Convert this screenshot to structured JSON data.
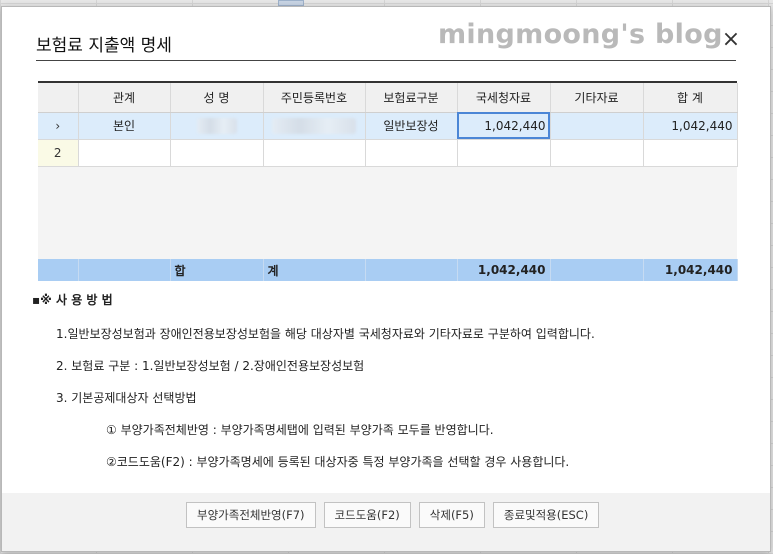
{
  "dialog": {
    "title": "보험료 지출액 명세",
    "watermark": "mingmoong's blog",
    "close_glyph": "×"
  },
  "grid": {
    "headers": [
      "관계",
      "성 명",
      "주민등록번호",
      "보험료구분",
      "국세청자료",
      "기타자료",
      "합 계"
    ],
    "rows": [
      {
        "marker": "›",
        "relation": "본인",
        "name": "",
        "id_number": "",
        "type": "일반보장성",
        "nts": "1,042,440",
        "other": "",
        "total": "1,042,440"
      },
      {
        "marker": "2",
        "relation": "",
        "name": "",
        "id_number": "",
        "type": "",
        "nts": "",
        "other": "",
        "total": ""
      }
    ],
    "totals": {
      "label1": "합",
      "label2": "계",
      "nts": "1,042,440",
      "total": "1,042,440"
    }
  },
  "notes": {
    "heading": "▪※ 사 용 방 법",
    "line1": "1.일반보장성보험과 장애인전용보장성보험을 해당 대상자별 국세청자료와 기타자료로 구분하여 입력합니다.",
    "line2": "2. 보험료 구분 : 1.일반보장성보험 / 2.장애인전용보장성보험",
    "line3": "3. 기본공제대상자 선택방법",
    "line4": "① 부양가족전체반영 : 부양가족명세탭에 입력된 부양가족 모두를 반영합니다.",
    "line5": "②코드도움(F2) : 부양가족명세에 등록된 대상자중 특정 부양가족을 선택할 경우 사용합니다."
  },
  "buttons": {
    "reflect_all": "부양가족전체반영(F7)",
    "code_help": "코드도움(F2)",
    "delete": "삭제(F5)",
    "apply_close": "종료및적용(ESC)"
  }
}
